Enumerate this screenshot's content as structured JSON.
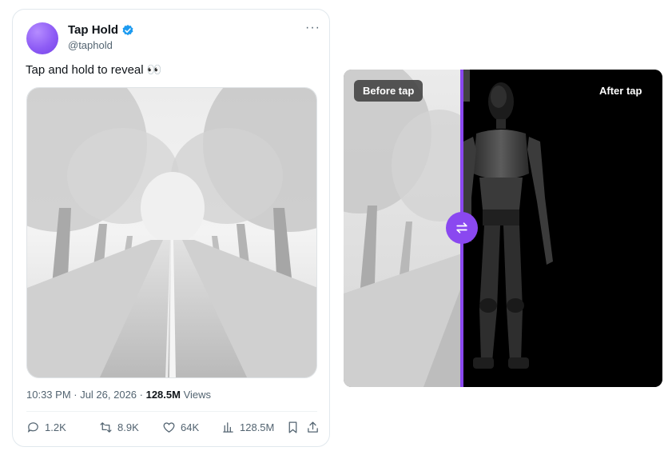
{
  "tweet": {
    "author_name": "Tap Hold",
    "handle": "@taphold",
    "text": "Tap and hold to reveal 👀",
    "more_icon": "more-horizontal-icon",
    "verified_color": "#1d9bf0",
    "timestamp": "10:33 PM · Jul 26, 2026 · ",
    "views_count": "128.5M",
    "views_label": " Views",
    "actions": {
      "reply": "1.2K",
      "retweet": "8.9K",
      "like": "64K",
      "views": "128.5M"
    }
  },
  "comparison": {
    "before_label": "Before tap",
    "after_label": "After tap",
    "accent_color": "#8a48f0",
    "swap_icon": "swap-arrows-icon"
  },
  "footer_text": ""
}
